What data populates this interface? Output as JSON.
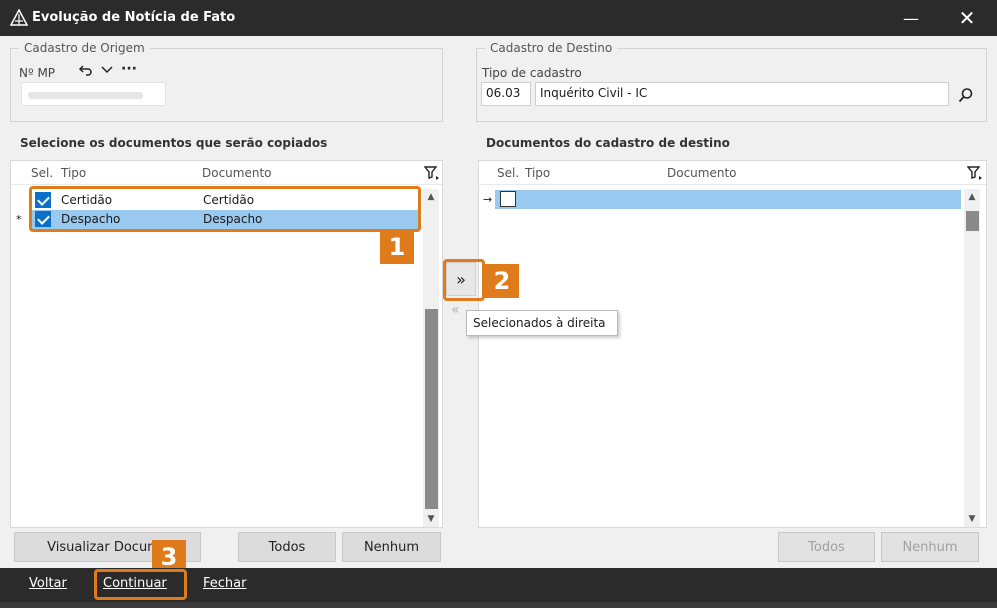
{
  "window": {
    "title": "Evolução de Notícia de Fato",
    "minimize_glyph": "—",
    "close_glyph": "✕"
  },
  "origin": {
    "legend": "Cadastro de Origem",
    "mp_label": "Nº MP",
    "more_glyph": "···"
  },
  "destination": {
    "legend": "Cadastro de Destino",
    "type_label": "Tipo de cadastro",
    "type_code": "06.03",
    "type_name": "Inquérito Civil - IC"
  },
  "left_panel": {
    "title": "Selecione os documentos que serão copiados",
    "columns": [
      "Sel.",
      "Tipo",
      "Documento"
    ],
    "rows": [
      {
        "checked": true,
        "tipo": "Certidão",
        "documento": "Certidão",
        "selected": false,
        "indicator": ""
      },
      {
        "checked": true,
        "tipo": "Despacho",
        "documento": "Despacho",
        "selected": true,
        "indicator": "*"
      }
    ],
    "buttons": {
      "view": "Visualizar Docume",
      "all": "Todos",
      "none": "Nenhum"
    }
  },
  "right_panel": {
    "title": "Documentos do cadastro de destino",
    "columns": [
      "Sel.",
      "Tipo",
      "Documento"
    ],
    "rows": [
      {
        "checked": false,
        "tipo": "",
        "documento": "",
        "selected": true,
        "indicator": "→"
      }
    ],
    "buttons": {
      "all": "Todos",
      "none": "Nenhum"
    }
  },
  "move": {
    "right_glyph": "»",
    "left_glyph": "«",
    "tooltip": "Selecionados à direita"
  },
  "badges": {
    "one": "1",
    "two": "2",
    "three": "3"
  },
  "footer": {
    "back": "Voltar",
    "continue": "Continuar",
    "close": "Fechar"
  },
  "colors": {
    "accent_orange": "#e07b1c",
    "selection_blue": "#99c9ee",
    "checkbox_blue": "#0b71c8",
    "titlebar_dark": "#2b2b2b"
  }
}
